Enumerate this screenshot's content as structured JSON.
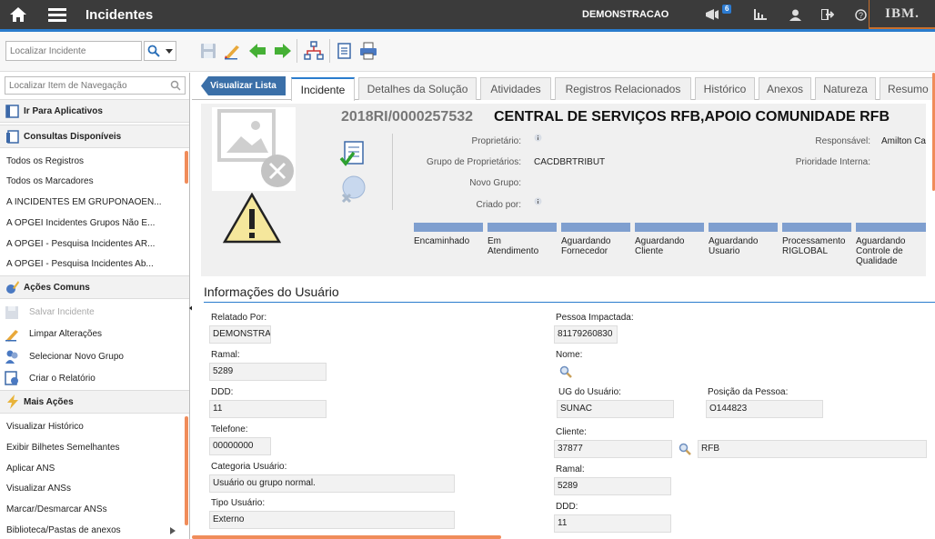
{
  "app": {
    "title": "Incidentes",
    "environment": "DEMONSTRACAO",
    "notifications_count": "6",
    "brand": "IBM."
  },
  "toolbar": {
    "search_placeholder": "Localizar Incidente"
  },
  "sidebar": {
    "search_placeholder": "Localizar Item de Navegação",
    "sections": {
      "apps": "Ir Para Aplicativos",
      "queries": "Consultas Disponíveis",
      "common": "Ações Comuns",
      "more": "Mais Ações"
    },
    "queries": [
      "Todos os Registros",
      "Todos os Marcadores",
      "A INCIDENTES EM GRUPONAOEN...",
      "A OPGEI Incidentes Grupos Não E...",
      "A OPGEI - Pesquisa Incidentes AR...",
      "A OPGEI - Pesquisa Incidentes Ab..."
    ],
    "common_actions": [
      "Salvar Incidente",
      "Limpar Alterações",
      "Selecionar Novo Grupo",
      "Criar o Relatório"
    ],
    "more_actions": [
      "Visualizar Histórico",
      "Exibir Bilhetes Semelhantes",
      "Aplicar ANS",
      "Visualizar ANSs",
      "Marcar/Desmarcar ANSs",
      "Biblioteca/Pastas de anexos"
    ]
  },
  "tabs": {
    "list": "Visualizar Lista",
    "items": [
      "Incidente",
      "Detalhes da Solução",
      "Atividades",
      "Registros Relacionados",
      "Histórico",
      "Anexos",
      "Natureza",
      "Resumo"
    ]
  },
  "header": {
    "ticket_id": "2018RI/0000257532",
    "title": "CENTRAL DE SERVIÇOS RFB,APOIO COMUNIDADE RFB",
    "owner_label": "Proprietário:",
    "owner_group_label": "Grupo de Proprietários:",
    "owner_group_value": "CACDBRTRIBUT",
    "new_group_label": "Novo Grupo:",
    "created_by_label": "Criado por:",
    "responsible_label": "Responsável:",
    "responsible_value": "Amilton Camp",
    "priority_label": "Prioridade Interna:"
  },
  "stages": [
    {
      "l1": "Encaminhado",
      "l2": "",
      "l3": ""
    },
    {
      "l1": "Em",
      "l2": "Atendimento",
      "l3": ""
    },
    {
      "l1": "Aguardando",
      "l2": "Fornecedor",
      "l3": ""
    },
    {
      "l1": "Aguardando",
      "l2": "Cliente",
      "l3": ""
    },
    {
      "l1": "Aguardando",
      "l2": "Usuario",
      "l3": ""
    },
    {
      "l1": "Processamento",
      "l2": "RIGLOBAL",
      "l3": ""
    },
    {
      "l1": "Aguardando",
      "l2": "Controle de",
      "l3": "Qualidade"
    }
  ],
  "user_info": {
    "section_title": "Informações do Usuário",
    "reported_by_label": "Relatado Por:",
    "reported_by": "DEMONSTRA",
    "ramal_label": "Ramal:",
    "ramal": "5289",
    "ddd_label": "DDD:",
    "ddd": "11",
    "phone_label": "Telefone:",
    "phone": "00000000",
    "category_label": "Categoria Usuário:",
    "category": "Usuário ou grupo normal.",
    "type_label": "Tipo Usuário:",
    "type": "Externo",
    "affected_label": "Pessoa Impactada:",
    "affected": "81179260830",
    "name_label": "Nome:",
    "ug_label": "UG do Usuário:",
    "ug": "SUNAC",
    "position_label": "Posição da Pessoa:",
    "position": "O144823",
    "client_label": "Cliente:",
    "client": "37877",
    "client_name": "RFB",
    "ramal2_label": "Ramal:",
    "ramal2": "5289",
    "ddd2_label": "DDD:",
    "ddd2": "11"
  }
}
